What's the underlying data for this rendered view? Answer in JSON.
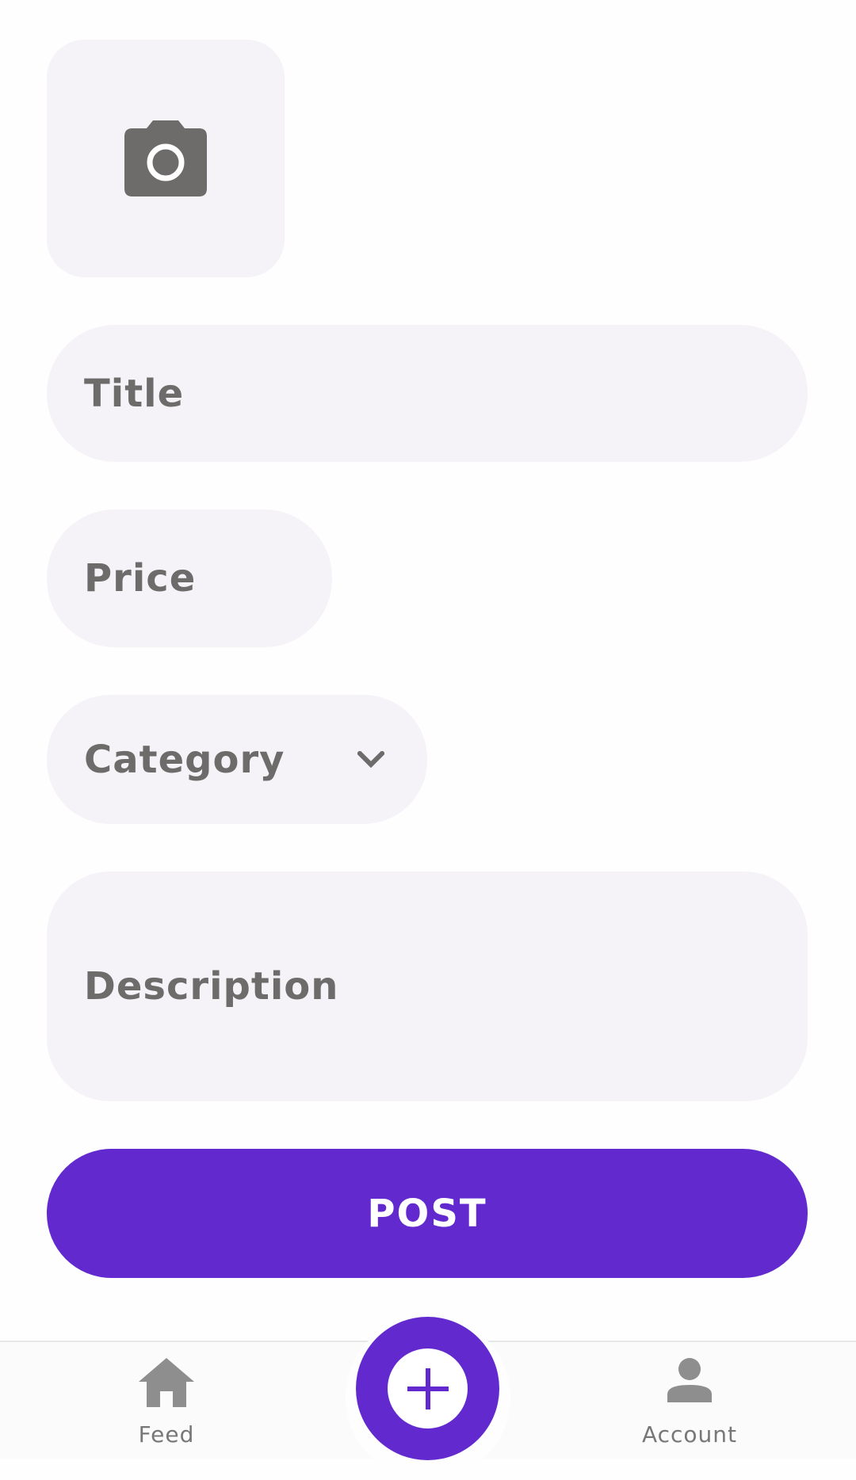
{
  "form": {
    "photo_icon": "camera-icon",
    "title_placeholder": "Title",
    "price_placeholder": "Price",
    "category_placeholder": "Category",
    "category_icon": "chevron-down-icon",
    "description_placeholder": "Description",
    "post_label": "POST"
  },
  "bottom_nav": {
    "feed": {
      "label": "Feed",
      "icon": "home-icon"
    },
    "add": {
      "icon": "plus-icon"
    },
    "account": {
      "label": "Account",
      "icon": "person-icon"
    }
  },
  "colors": {
    "accent": "#6229cf",
    "field_background": "#f5f3f8",
    "placeholder_text": "#6e6b6b",
    "icon_gray": "#6e6b6b"
  }
}
